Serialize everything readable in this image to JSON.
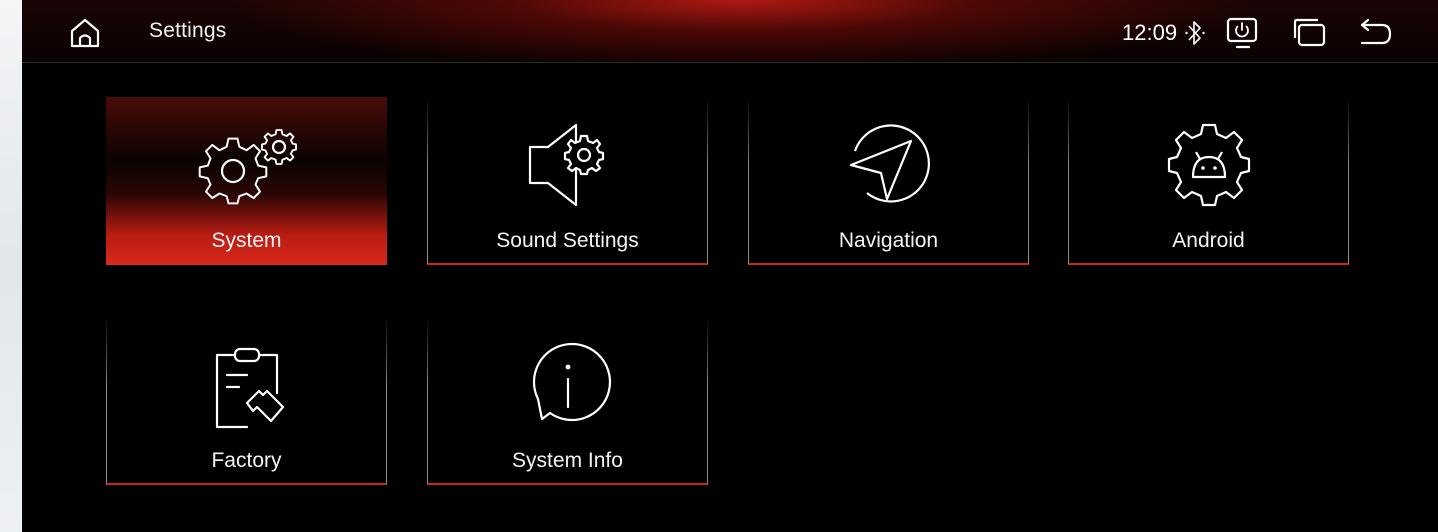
{
  "header": {
    "title": "Settings",
    "clock": "12:09",
    "icons": [
      "home-icon",
      "bluetooth-icon",
      "screen-power-icon",
      "multi-window-icon",
      "back-icon"
    ]
  },
  "tiles": [
    {
      "label": "System",
      "icon": "gears-icon",
      "selected": true
    },
    {
      "label": "Sound Settings",
      "icon": "speaker-gear-icon",
      "selected": false
    },
    {
      "label": "Navigation",
      "icon": "navigation-arrow-icon",
      "selected": false
    },
    {
      "label": "Android",
      "icon": "android-gear-icon",
      "selected": false
    },
    {
      "label": "Factory",
      "icon": "clipboard-wrench-icon",
      "selected": false
    },
    {
      "label": "System Info",
      "icon": "info-bubble-icon",
      "selected": false
    }
  ],
  "colors": {
    "accent": "#d8291b",
    "background": "#000000",
    "text": "#f4f4f4"
  }
}
